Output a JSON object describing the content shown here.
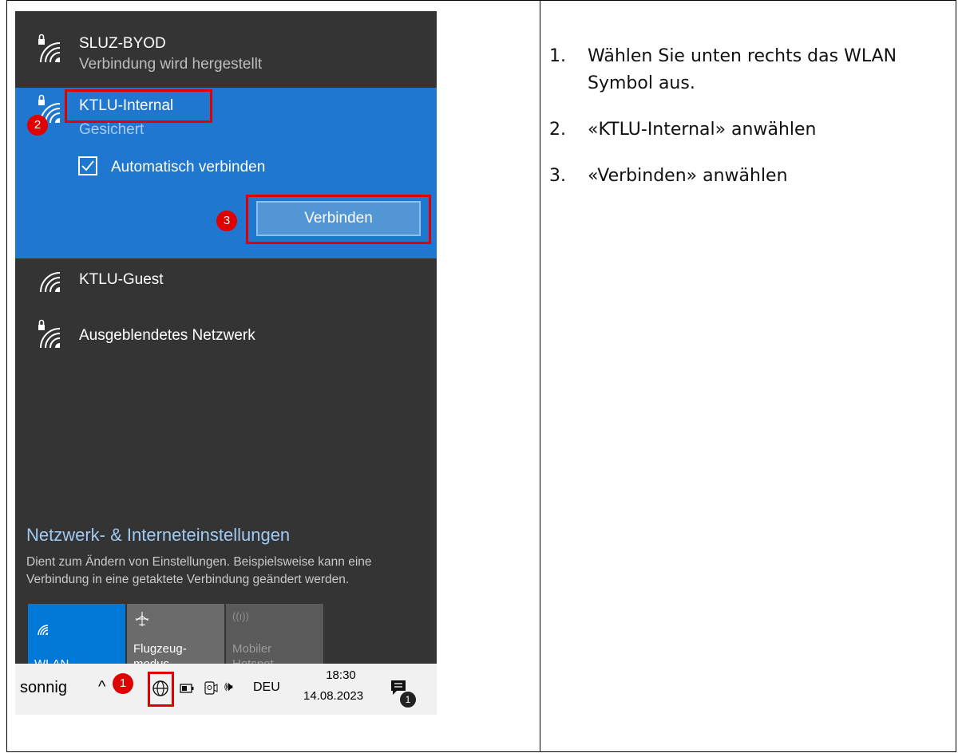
{
  "networks": {
    "items": [
      {
        "name": "SLUZ-BYOD",
        "status": "Verbindung wird hergestellt"
      },
      {
        "name": "KTLU-Internal",
        "status": "Gesichert"
      },
      {
        "name": "KTLU-Guest",
        "status": ""
      },
      {
        "name": "Ausgeblendetes Netzwerk",
        "status": ""
      }
    ],
    "auto_connect_label": "Automatisch verbinden",
    "connect_button": "Verbinden"
  },
  "settings": {
    "title": "Netzwerk- & Interneteinstellungen",
    "description": "Dient zum Ändern von Einstellungen. Beispielsweise kann eine Verbindung in eine getaktete Verbindung geändert werden."
  },
  "quick_actions": [
    {
      "label": "WLAN",
      "icon": "wifi-icon",
      "active": true
    },
    {
      "label_line1": "Flugzeug-",
      "label_line2": "modus",
      "icon": "airplane-icon",
      "active": false
    },
    {
      "label_line1": "Mobiler",
      "label_line2": "Hotspot",
      "icon": "hotspot-icon",
      "active": false,
      "disabled": true
    }
  ],
  "taskbar": {
    "weather": "sonnig",
    "language": "DEU",
    "time": "18:30",
    "date": "14.08.2023",
    "notification_count": "1"
  },
  "badges": [
    "1",
    "2",
    "3"
  ],
  "instructions": [
    {
      "num": "1.",
      "text": "Wählen Sie unten rechts das WLAN Symbol aus."
    },
    {
      "num": "2.",
      "text": "«KTLU-Internal» anwählen"
    },
    {
      "num": "3.",
      "text": "«Verbinden» anwählen"
    }
  ],
  "colors": {
    "panel_bg": "#343434",
    "selected_bg": "#1f77cf",
    "accent": "#0078d7",
    "highlight_red": "#e00000"
  }
}
